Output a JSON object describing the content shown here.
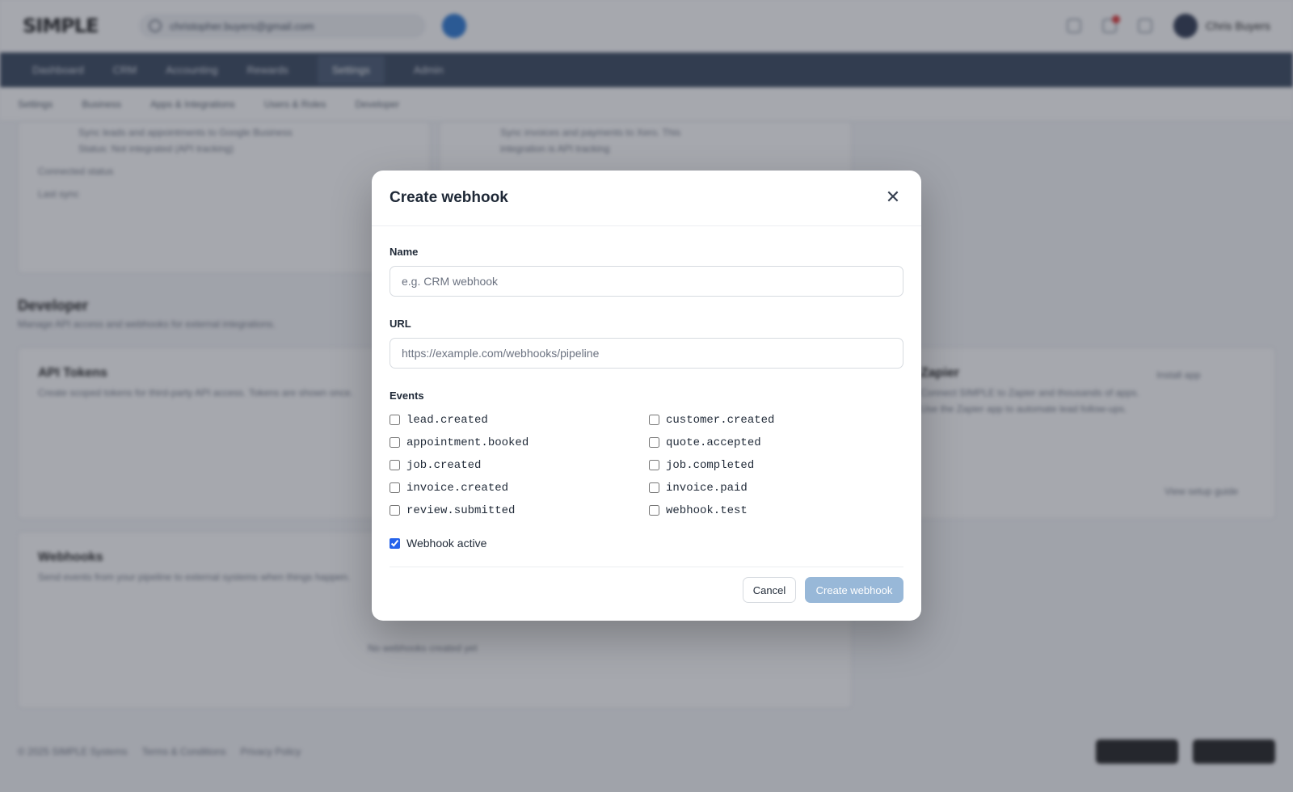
{
  "background": {
    "logo": "SIMPLE",
    "search_value": "christopher.buyers@gmail.com",
    "user_name": "Chris Buyers",
    "nav": [
      "Dashboard",
      "CRM",
      "Accounting",
      "Rewards",
      "Settings",
      "Admin"
    ],
    "nav_active_index": 4,
    "subnav": [
      "Settings",
      "Business",
      "Apps & Integrations",
      "Users & Roles",
      "Developer"
    ],
    "card1": {
      "line1": "Sync leads and appointments to Google Business",
      "line2": "Status: Not integrated (API tracking)",
      "row1": "Connected status",
      "row2": "Last sync"
    },
    "card2": {
      "line1": "Sync invoices and payments to Xero. This",
      "line2": "integration is API tracking"
    },
    "developer_title": "Developer",
    "developer_sub": "Manage API access and webhooks for external integrations.",
    "api_title": "API Tokens",
    "api_sub": "Create scoped tokens for third-party API access. Tokens are shown once.",
    "zapier_title": "Zapier",
    "zapier_sub1": "Connect SIMPLE to Zapier and thousands of apps.",
    "zapier_sub2": "Use the Zapier app to automate lead follow-ups.",
    "zapier_link": "Install app",
    "zapier_guide": "View setup guide",
    "webhooks_title": "Webhooks",
    "webhooks_sub": "Send events from your pipeline to external systems when things happen.",
    "webhooks_empty": "No webhooks created yet",
    "footer": [
      "© 2025 SIMPLE Systems",
      "Terms & Conditions",
      "Privacy Policy"
    ]
  },
  "modal": {
    "title": "Create webhook",
    "close_icon": "close-icon",
    "name_label": "Name",
    "name_placeholder": "e.g. CRM webhook",
    "name_value": "",
    "url_label": "URL",
    "url_placeholder": "https://example.com/webhooks/pipeline",
    "url_value": "",
    "events_label": "Events",
    "events": [
      {
        "name": "lead.created",
        "checked": false
      },
      {
        "name": "customer.created",
        "checked": false
      },
      {
        "name": "appointment.booked",
        "checked": false
      },
      {
        "name": "quote.accepted",
        "checked": false
      },
      {
        "name": "job.created",
        "checked": false
      },
      {
        "name": "job.completed",
        "checked": false
      },
      {
        "name": "invoice.created",
        "checked": false
      },
      {
        "name": "invoice.paid",
        "checked": false
      },
      {
        "name": "review.submitted",
        "checked": false
      },
      {
        "name": "webhook.test",
        "checked": false
      }
    ],
    "active_label": "Webhook active",
    "active_checked": true,
    "cancel_label": "Cancel",
    "create_label": "Create webhook"
  },
  "colors": {
    "nav_bg": "#2a3a52",
    "primary_disabled": "#98b8d8",
    "checkbox_accent": "#2563eb"
  }
}
